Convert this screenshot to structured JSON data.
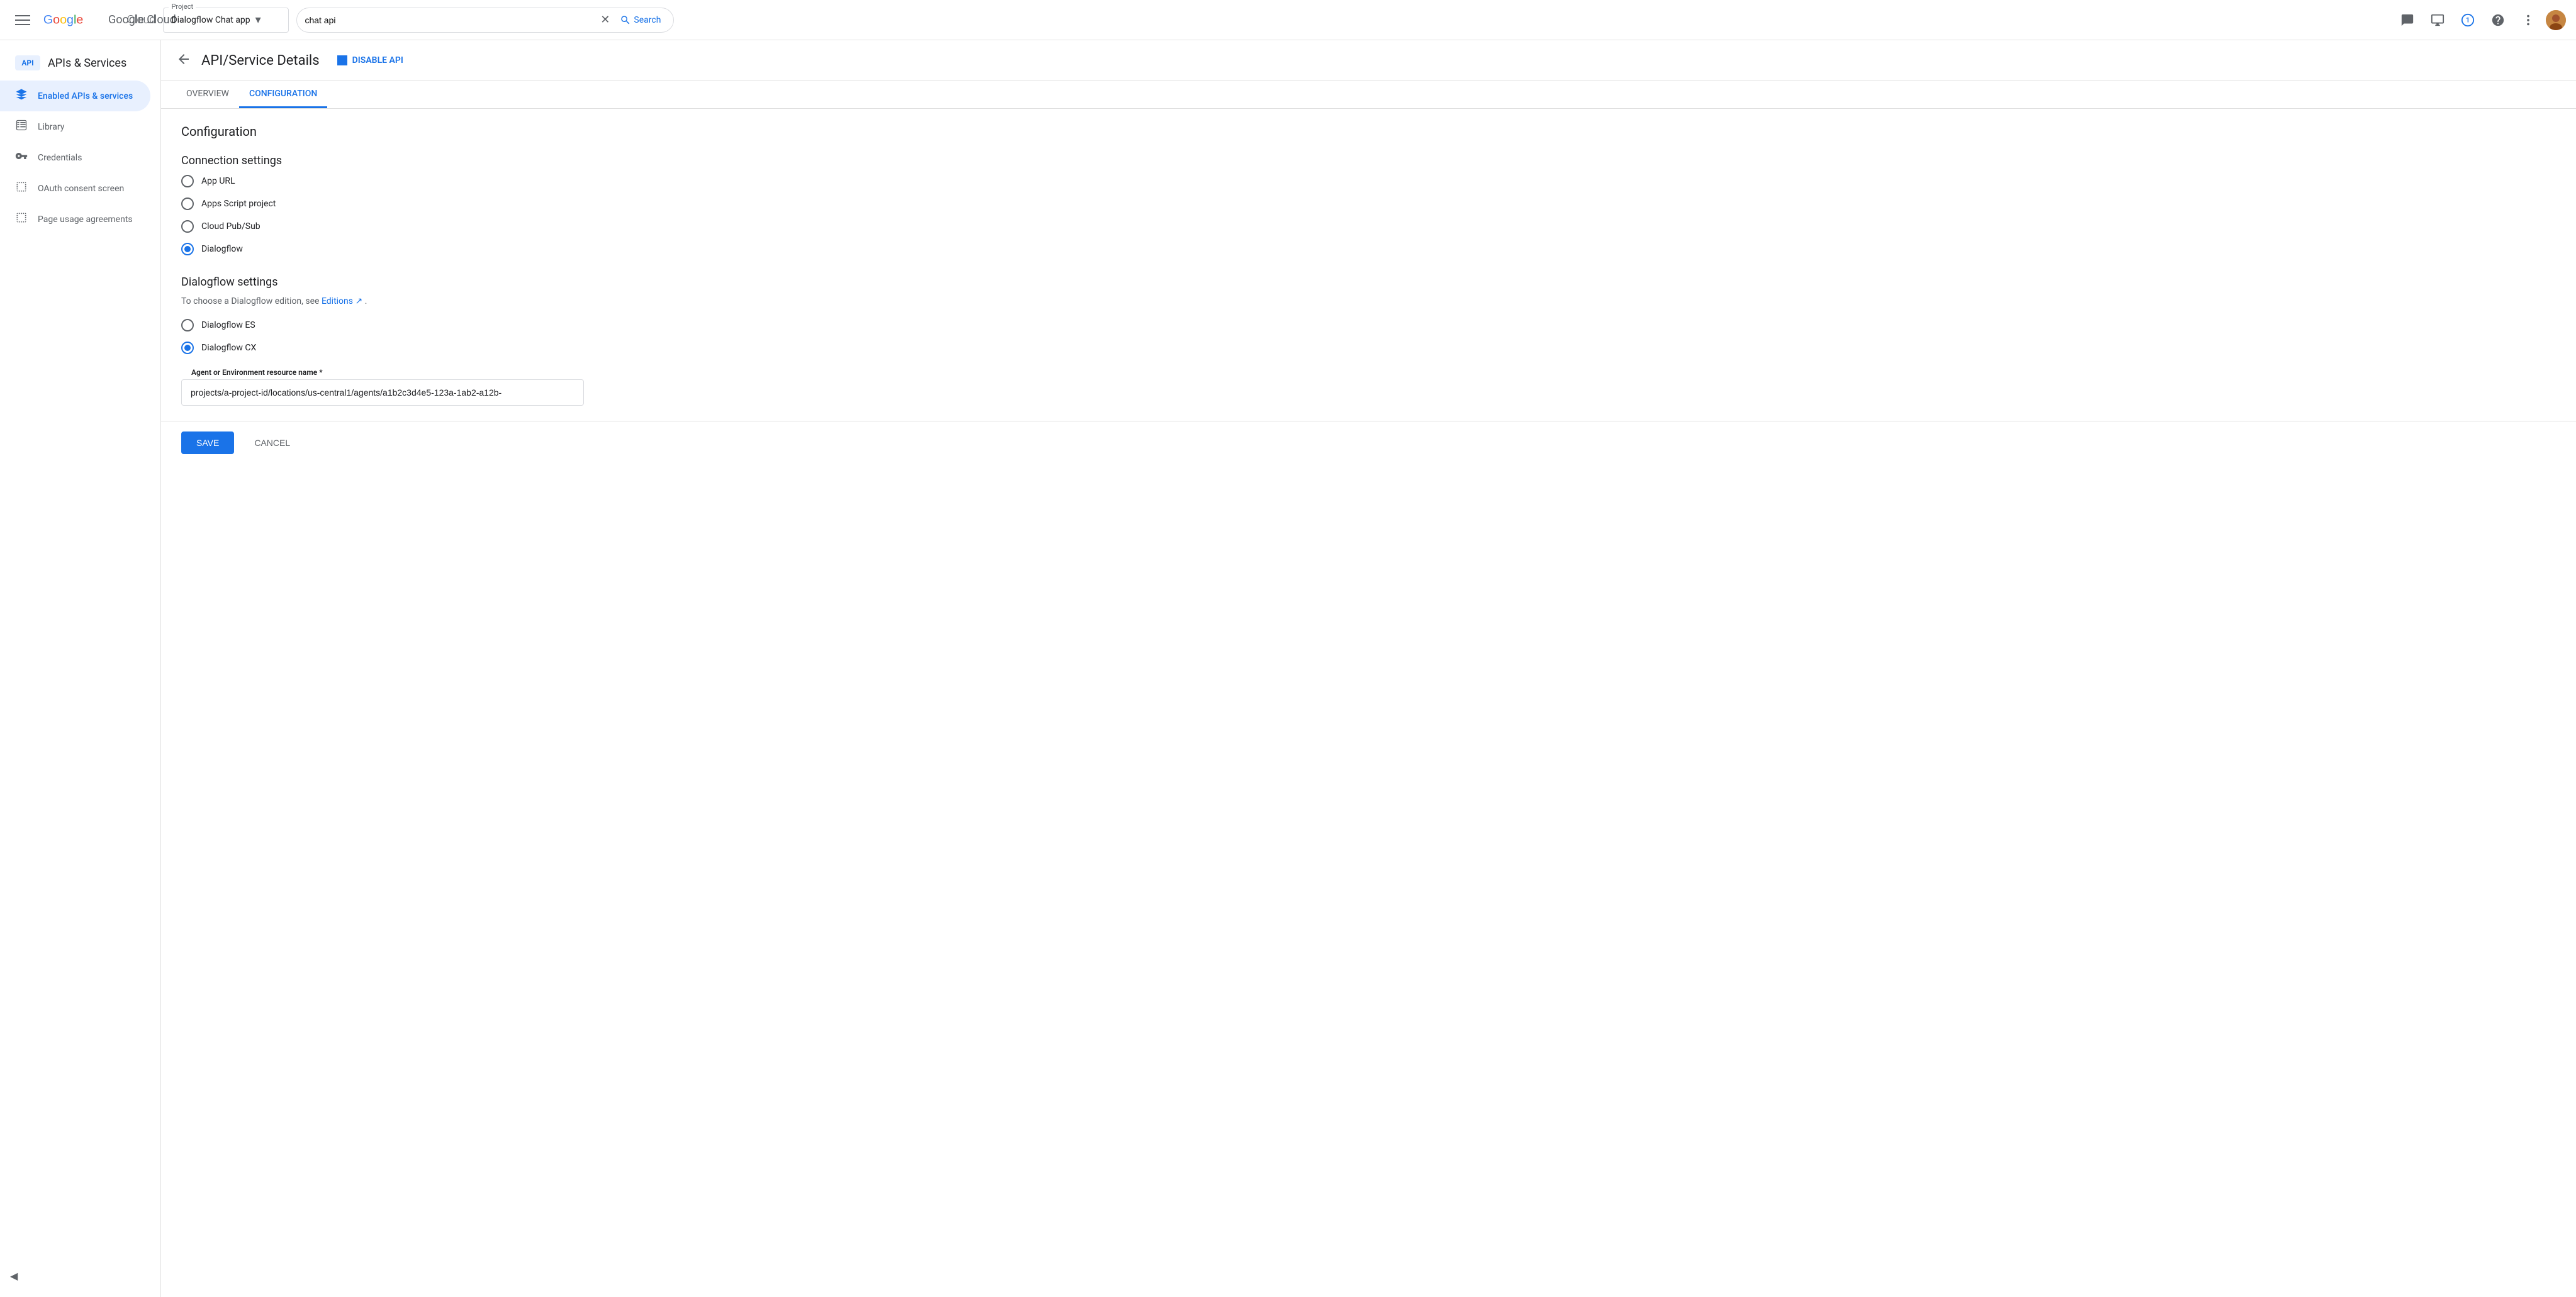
{
  "topbar": {
    "hamburger_label": "☰",
    "google_logo": "Google Cloud",
    "project_label": "Project",
    "project_name": "Dialogflow Chat app",
    "search_value": "chat api",
    "search_placeholder": "Search",
    "search_button_label": "Search",
    "notifications_icon": "📋",
    "display_icon": "🖥",
    "notification_count": "1",
    "help_icon": "?",
    "more_icon": "⋮"
  },
  "sidebar": {
    "api_badge": "API",
    "title": "APIs & Services",
    "items": [
      {
        "id": "enabled-apis",
        "label": "Enabled APIs & services",
        "icon": "✦",
        "active": true
      },
      {
        "id": "library",
        "label": "Library",
        "icon": "▦"
      },
      {
        "id": "credentials",
        "label": "Credentials",
        "icon": "🔑"
      },
      {
        "id": "oauth",
        "label": "OAuth consent screen",
        "icon": "⚙"
      },
      {
        "id": "page-usage",
        "label": "Page usage agreements",
        "icon": "⚙"
      }
    ],
    "collapse_icon": "◀"
  },
  "page": {
    "back_label": "←",
    "title": "API/Service Details",
    "disable_api_label": "DISABLE API",
    "tabs": [
      {
        "id": "overview",
        "label": "OVERVIEW"
      },
      {
        "id": "configuration",
        "label": "CONFIGURATION",
        "active": true
      }
    ],
    "section_title": "Configuration",
    "connection_settings_title": "Connection settings",
    "connection_options": [
      {
        "id": "app-url",
        "label": "App URL",
        "selected": false
      },
      {
        "id": "apps-script",
        "label": "Apps Script project",
        "selected": false
      },
      {
        "id": "cloud-pubsub",
        "label": "Cloud Pub/Sub",
        "selected": false
      },
      {
        "id": "dialogflow",
        "label": "Dialogflow",
        "selected": true
      }
    ],
    "dialogflow_settings_title": "Dialogflow settings",
    "dialogflow_helper_text": "To choose a Dialogflow edition, see ",
    "editions_link_text": "Editions",
    "dialogflow_editions": [
      {
        "id": "es",
        "label": "Dialogflow ES",
        "selected": false
      },
      {
        "id": "cx",
        "label": "Dialogflow CX",
        "selected": true
      }
    ],
    "agent_input_label": "Agent or Environment resource name",
    "agent_required_marker": "*",
    "agent_value": "projects/a-project-id/locations/us-central1/agents/a1b2c3d4e5-123a-1ab2-a12b-",
    "save_label": "SAVE",
    "cancel_label": "CANCEL"
  }
}
